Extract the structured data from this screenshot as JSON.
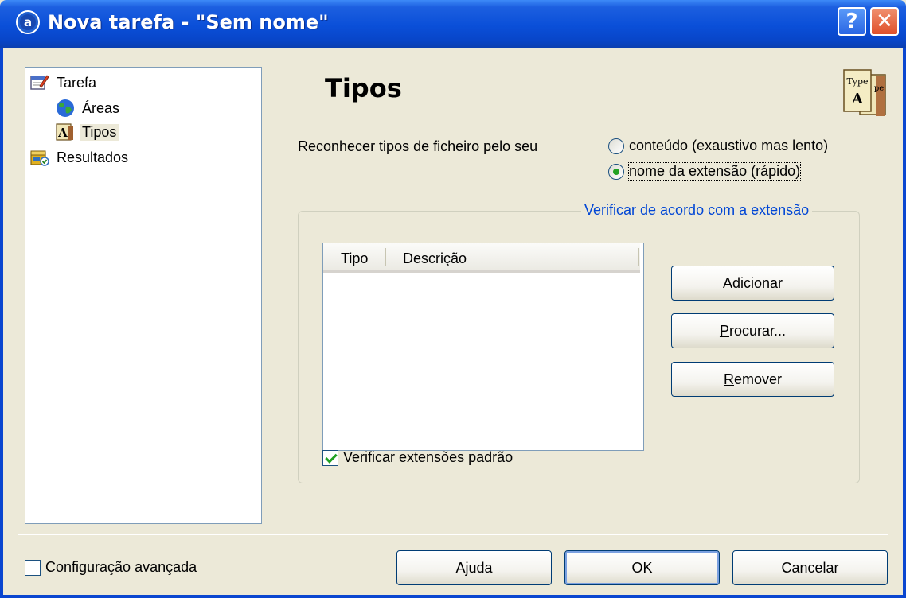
{
  "window": {
    "title": "Nova tarefa - \"Sem nome\"",
    "help_glyph": "?",
    "close_glyph": "✕"
  },
  "tree": {
    "items": [
      {
        "label": "Tarefa",
        "icon": "task-edit-icon"
      },
      {
        "label": "Áreas",
        "icon": "globe-icon"
      },
      {
        "label": "Tipos",
        "icon": "types-icon",
        "selected": true
      },
      {
        "label": "Resultados",
        "icon": "results-icon"
      }
    ]
  },
  "page": {
    "heading": "Tipos",
    "recognize_label": "Reconhecer tipos de ficheiro pelo seu",
    "radio_content": "conteúdo (exaustivo mas lento)",
    "radio_extension": "nome da extensão (rápido)",
    "selected_radio": "extension",
    "group_title": "Verificar de acordo com a extensão",
    "columns": [
      "Tipo",
      "Descrição"
    ],
    "rows": [],
    "buttons": {
      "add": "Adicionar",
      "browse": "Procurar...",
      "remove": "Remover"
    },
    "check_standard": "Verificar extensões padrão",
    "check_standard_checked": true
  },
  "footer": {
    "advanced": "Configuração avançada",
    "advanced_checked": false,
    "help": "Ajuda",
    "ok": "OK",
    "cancel": "Cancelar"
  },
  "colors": {
    "titlebar": "#0a4fd8",
    "group_title": "#0046d5",
    "dialog_bg": "#ece9d8"
  }
}
